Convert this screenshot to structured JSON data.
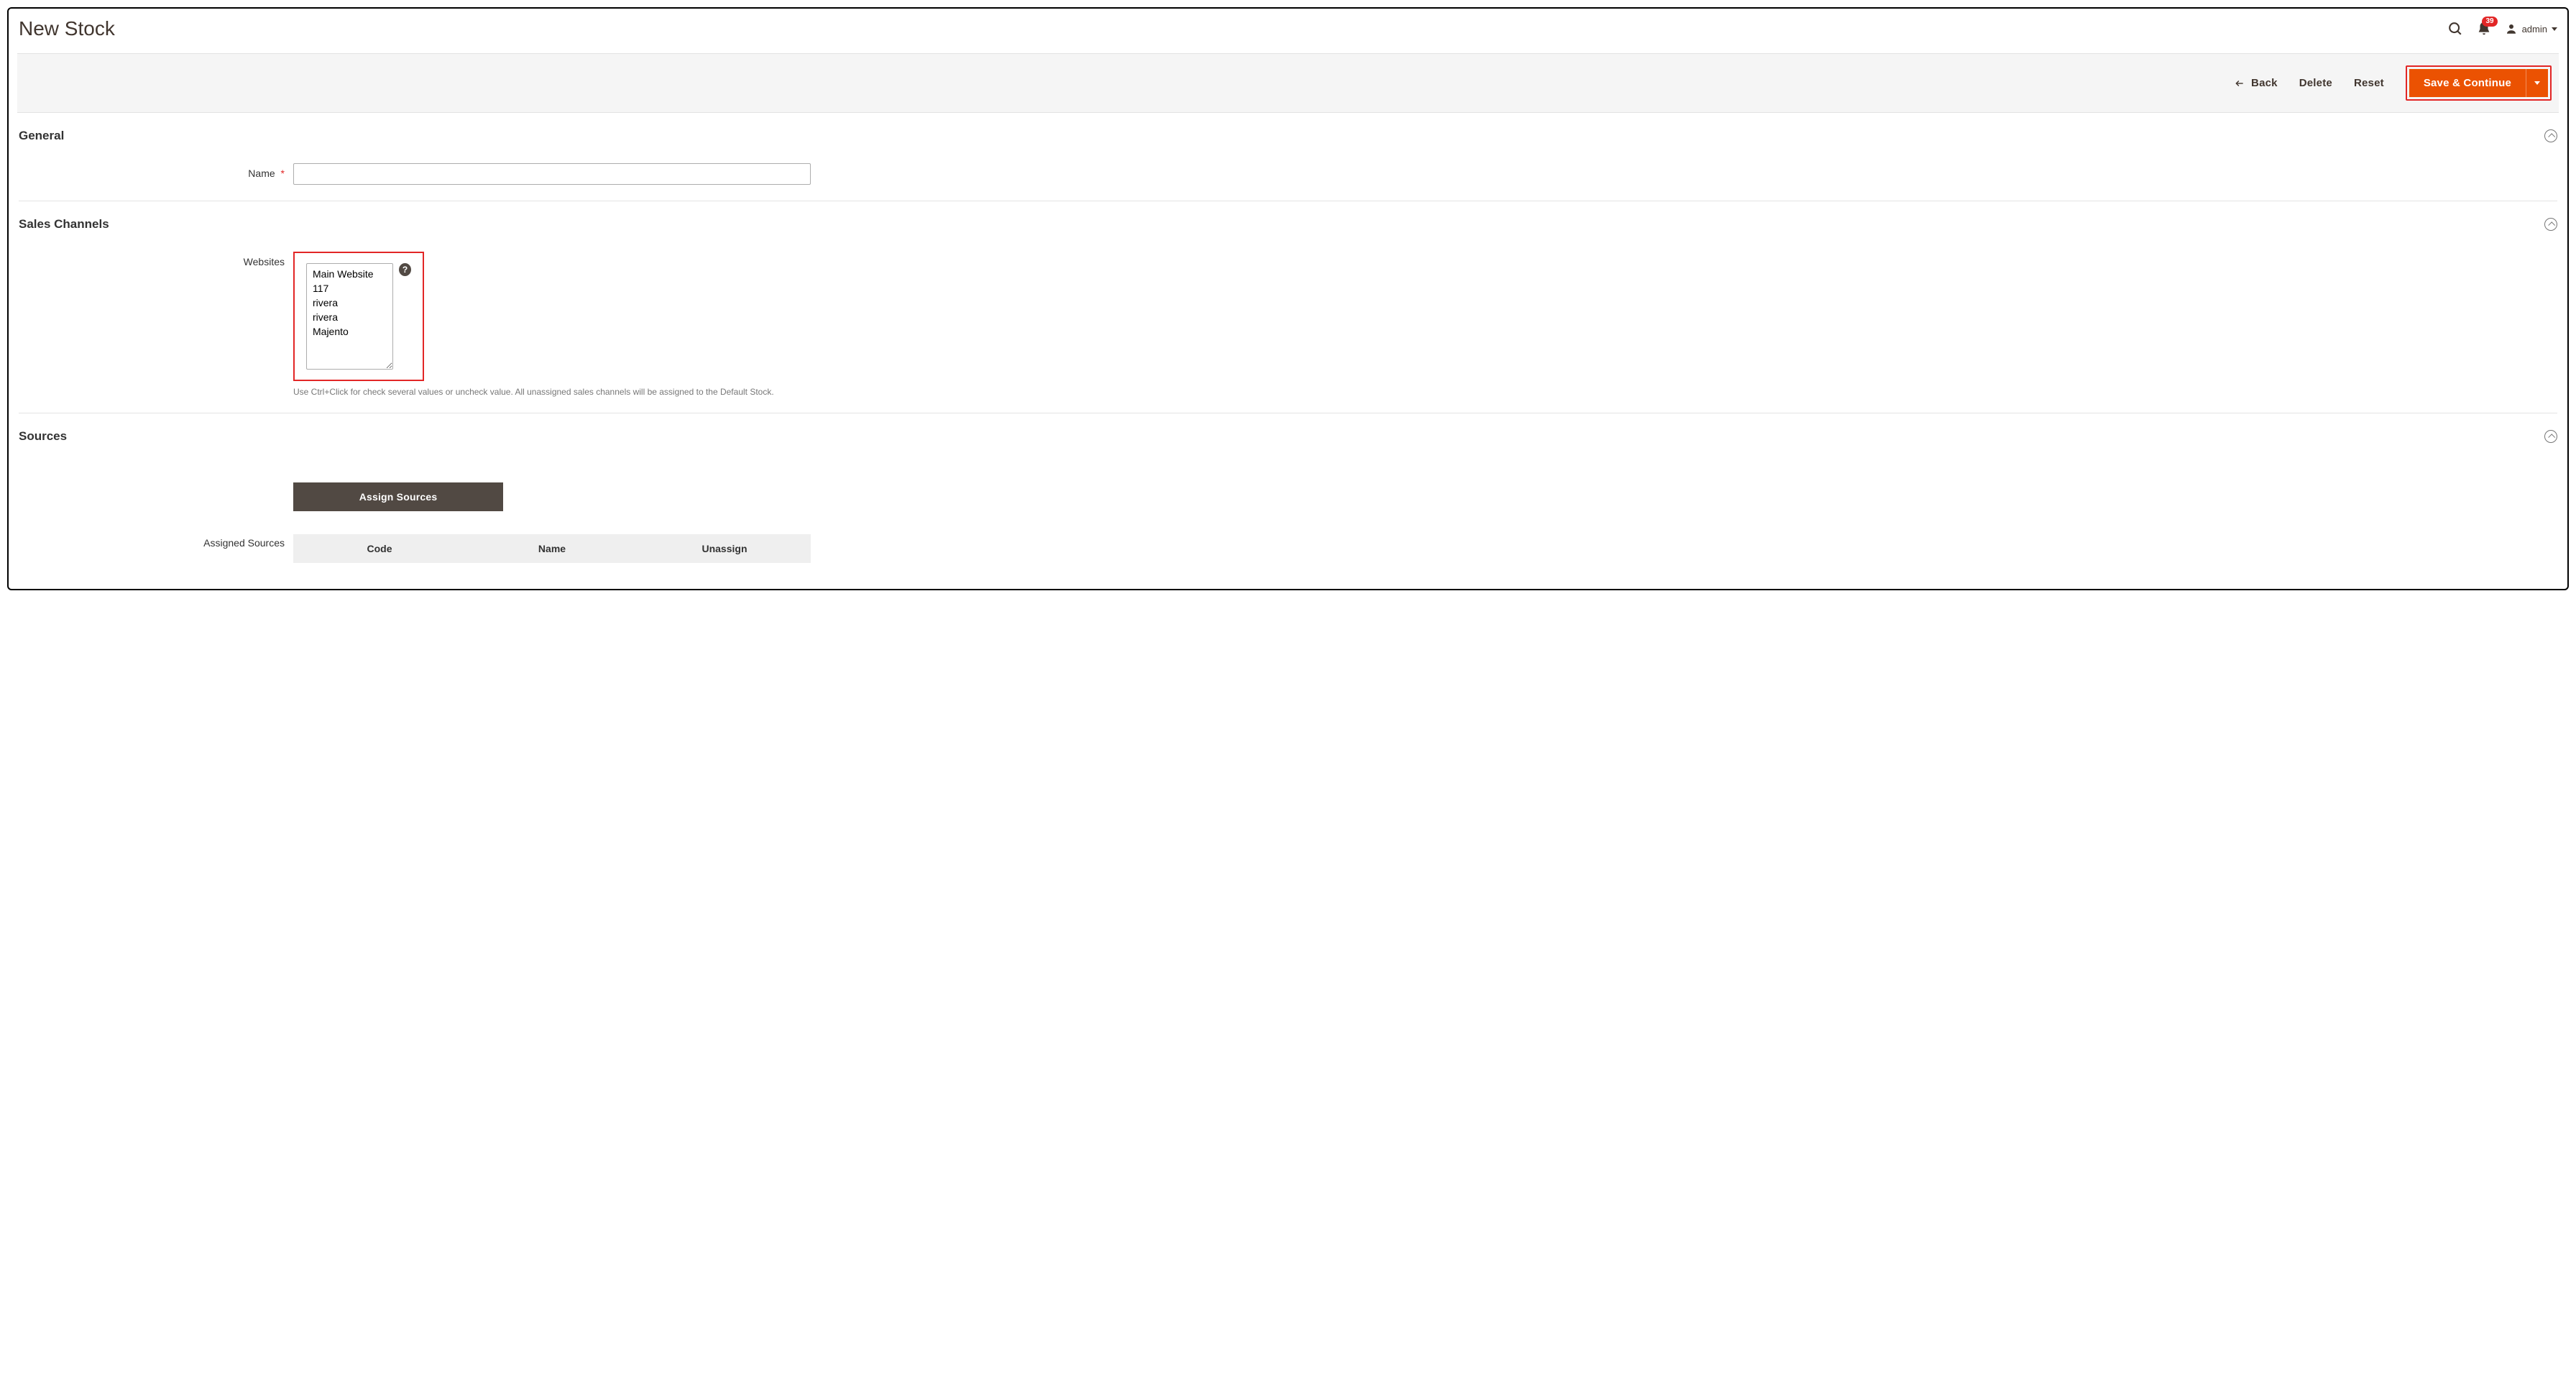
{
  "header": {
    "title": "New Stock",
    "admin_label": "admin",
    "notification_count": "39"
  },
  "actions": {
    "back": "Back",
    "delete": "Delete",
    "reset": "Reset",
    "save_continue": "Save & Continue"
  },
  "sections": {
    "general": {
      "title": "General",
      "name_label": "Name",
      "name_value": ""
    },
    "sales_channels": {
      "title": "Sales Channels",
      "websites_label": "Websites",
      "websites_options": [
        "Main Website",
        "117",
        "rivera",
        "rivera",
        "Majento"
      ],
      "hint": "Use Ctrl+Click for check several values or uncheck value. All unassigned sales channels will be assigned to the Default Stock."
    },
    "sources": {
      "title": "Sources",
      "assign_btn": "Assign Sources",
      "assigned_label": "Assigned Sources",
      "cols": {
        "code": "Code",
        "name": "Name",
        "unassign": "Unassign"
      }
    }
  }
}
